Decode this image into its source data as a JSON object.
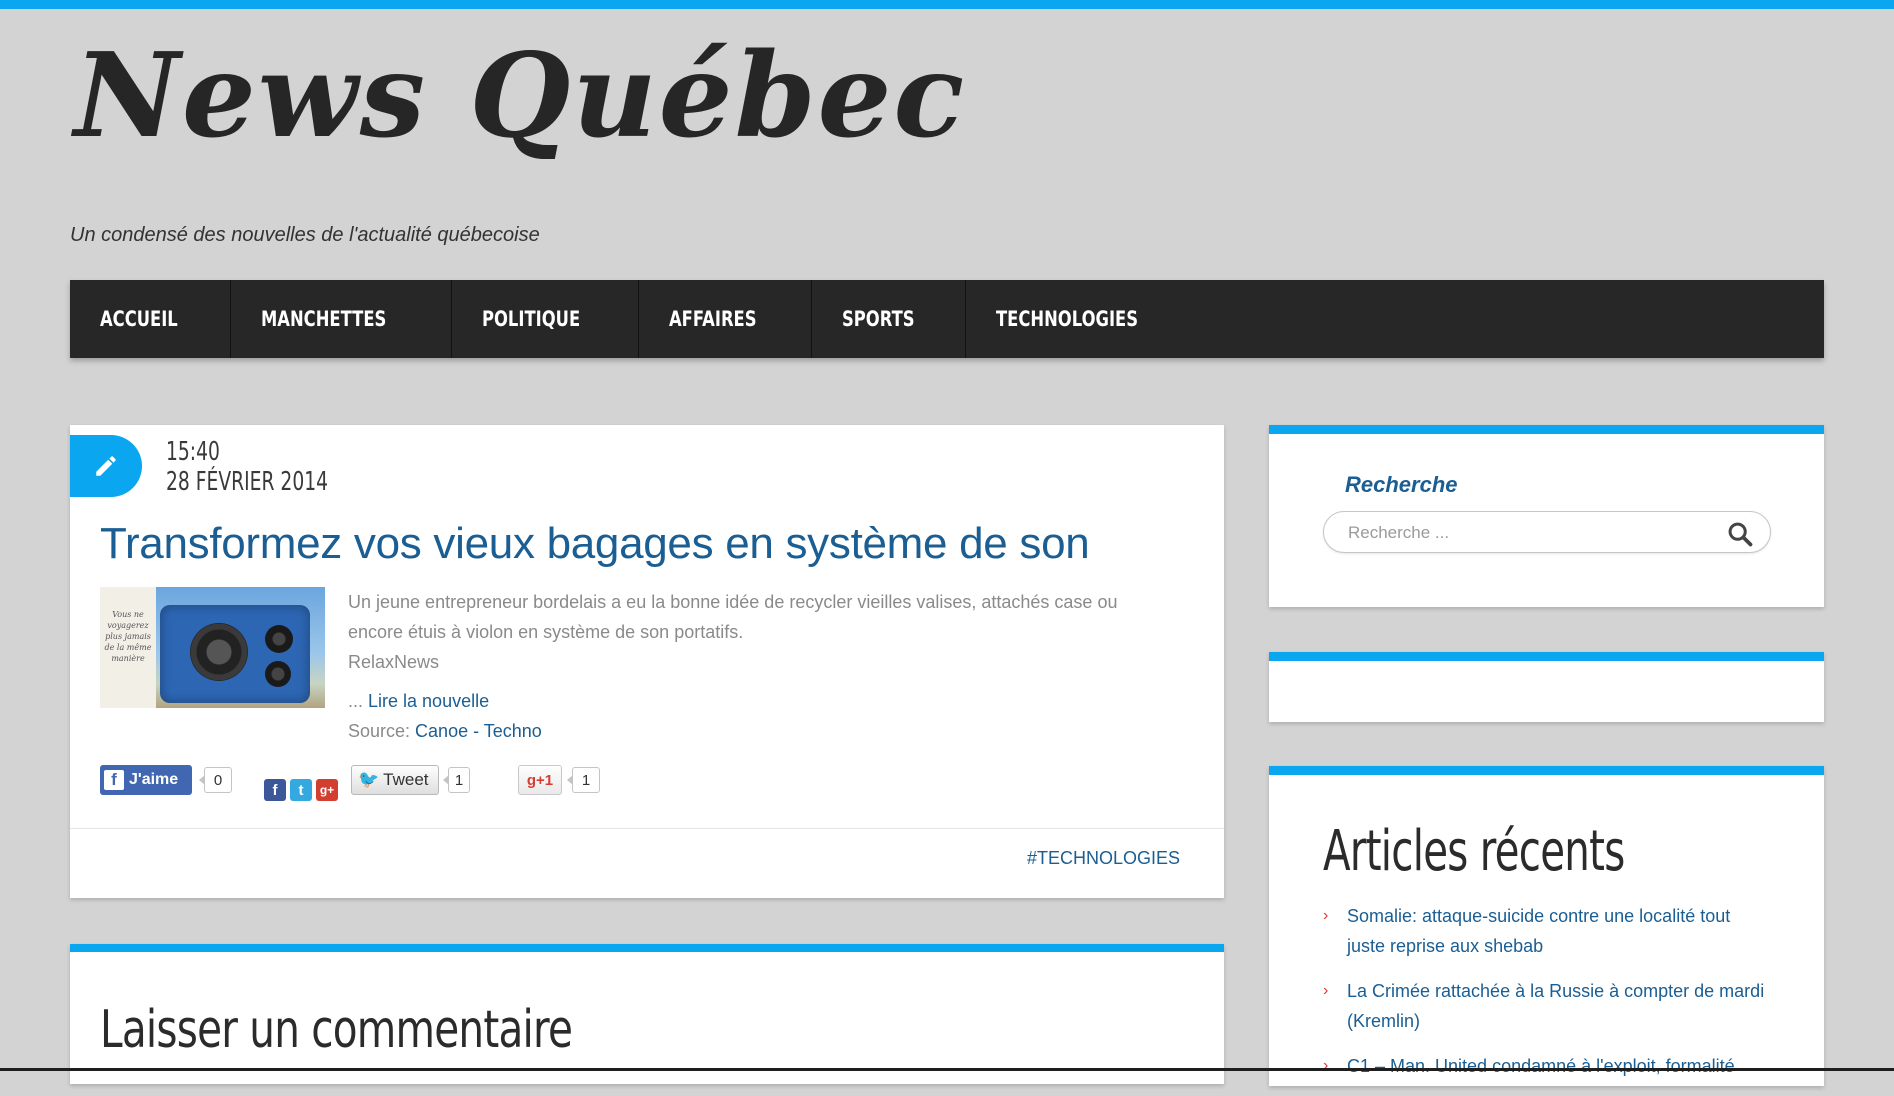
{
  "site": {
    "title": "News Québec",
    "tagline": "Un condensé des nouvelles de l'actualité québecoise"
  },
  "nav": {
    "items": [
      {
        "label": "ACCUEIL"
      },
      {
        "label": "MANCHETTES"
      },
      {
        "label": "POLITIQUE"
      },
      {
        "label": "AFFAIRES"
      },
      {
        "label": "SPORTS"
      },
      {
        "label": "TECHNOLOGIES"
      }
    ]
  },
  "post": {
    "time": "15:40",
    "date": "28 FÉVRIER 2014",
    "title": "Transformez vos vieux bagages en système de son",
    "thumb_caption": "Vous ne voyagerez plus jamais de la même manière",
    "excerpt": "Un jeune entrepreneur bordelais a eu la bonne idée de recycler vieilles valises, attachés case ou encore étuis à violon en système de son portatifs.",
    "excerpt_source": "RelaxNews",
    "read_more_prefix": "... ",
    "read_more_label": "Lire la nouvelle",
    "source_prefix": "Source: ",
    "source_label": "Canoe - Techno",
    "tag": "#TECHNOLOGIES",
    "share": {
      "fb_like_label": "J'aime",
      "fb_like_count": "0",
      "tweet_label": "Tweet",
      "tweet_count": "1",
      "gplus_label": "+1",
      "gplus_count": "1"
    }
  },
  "comments": {
    "title": "Laisser un commentaire"
  },
  "sidebar": {
    "search": {
      "title": "Recherche",
      "placeholder": "Recherche ..."
    },
    "recent": {
      "title": "Articles récents",
      "items": [
        {
          "label": "Somalie: attaque-suicide contre une localité tout juste reprise aux shebab"
        },
        {
          "label": "La Crimée rattachée à la Russie à compter de mardi (Kremlin)"
        },
        {
          "label": "C1 – Man. United condamné à l'exploit, formalité"
        }
      ]
    }
  },
  "colors": {
    "accent": "#0aa6ef",
    "nav_bg": "#272727",
    "link": "#1a5e93",
    "page_bg": "#d3d3d3"
  }
}
